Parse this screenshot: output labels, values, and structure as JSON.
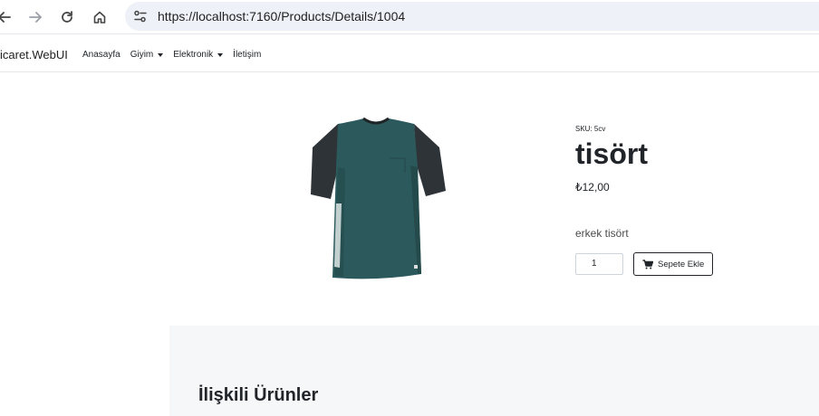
{
  "browser": {
    "url": "https://localhost:7160/Products/Details/1004"
  },
  "navbar": {
    "brand": "icaret.WebUI",
    "links": [
      {
        "label": "Anasayfa",
        "dropdown": false
      },
      {
        "label": "Giyim",
        "dropdown": true
      },
      {
        "label": "Elektronik",
        "dropdown": true
      },
      {
        "label": "İletişim",
        "dropdown": false
      }
    ]
  },
  "product": {
    "sku": "SKU: 5cv",
    "title": "tisört",
    "price": "₺12,00",
    "description": "erkek tisört",
    "quantity": "1",
    "add_to_cart_label": "Sepete Ekle",
    "image": {
      "icon": "tshirt-image",
      "body_color": "#2c5a5c",
      "sleeve_color": "#2e3338"
    }
  },
  "related": {
    "title": "İlişkili Ürünler"
  }
}
